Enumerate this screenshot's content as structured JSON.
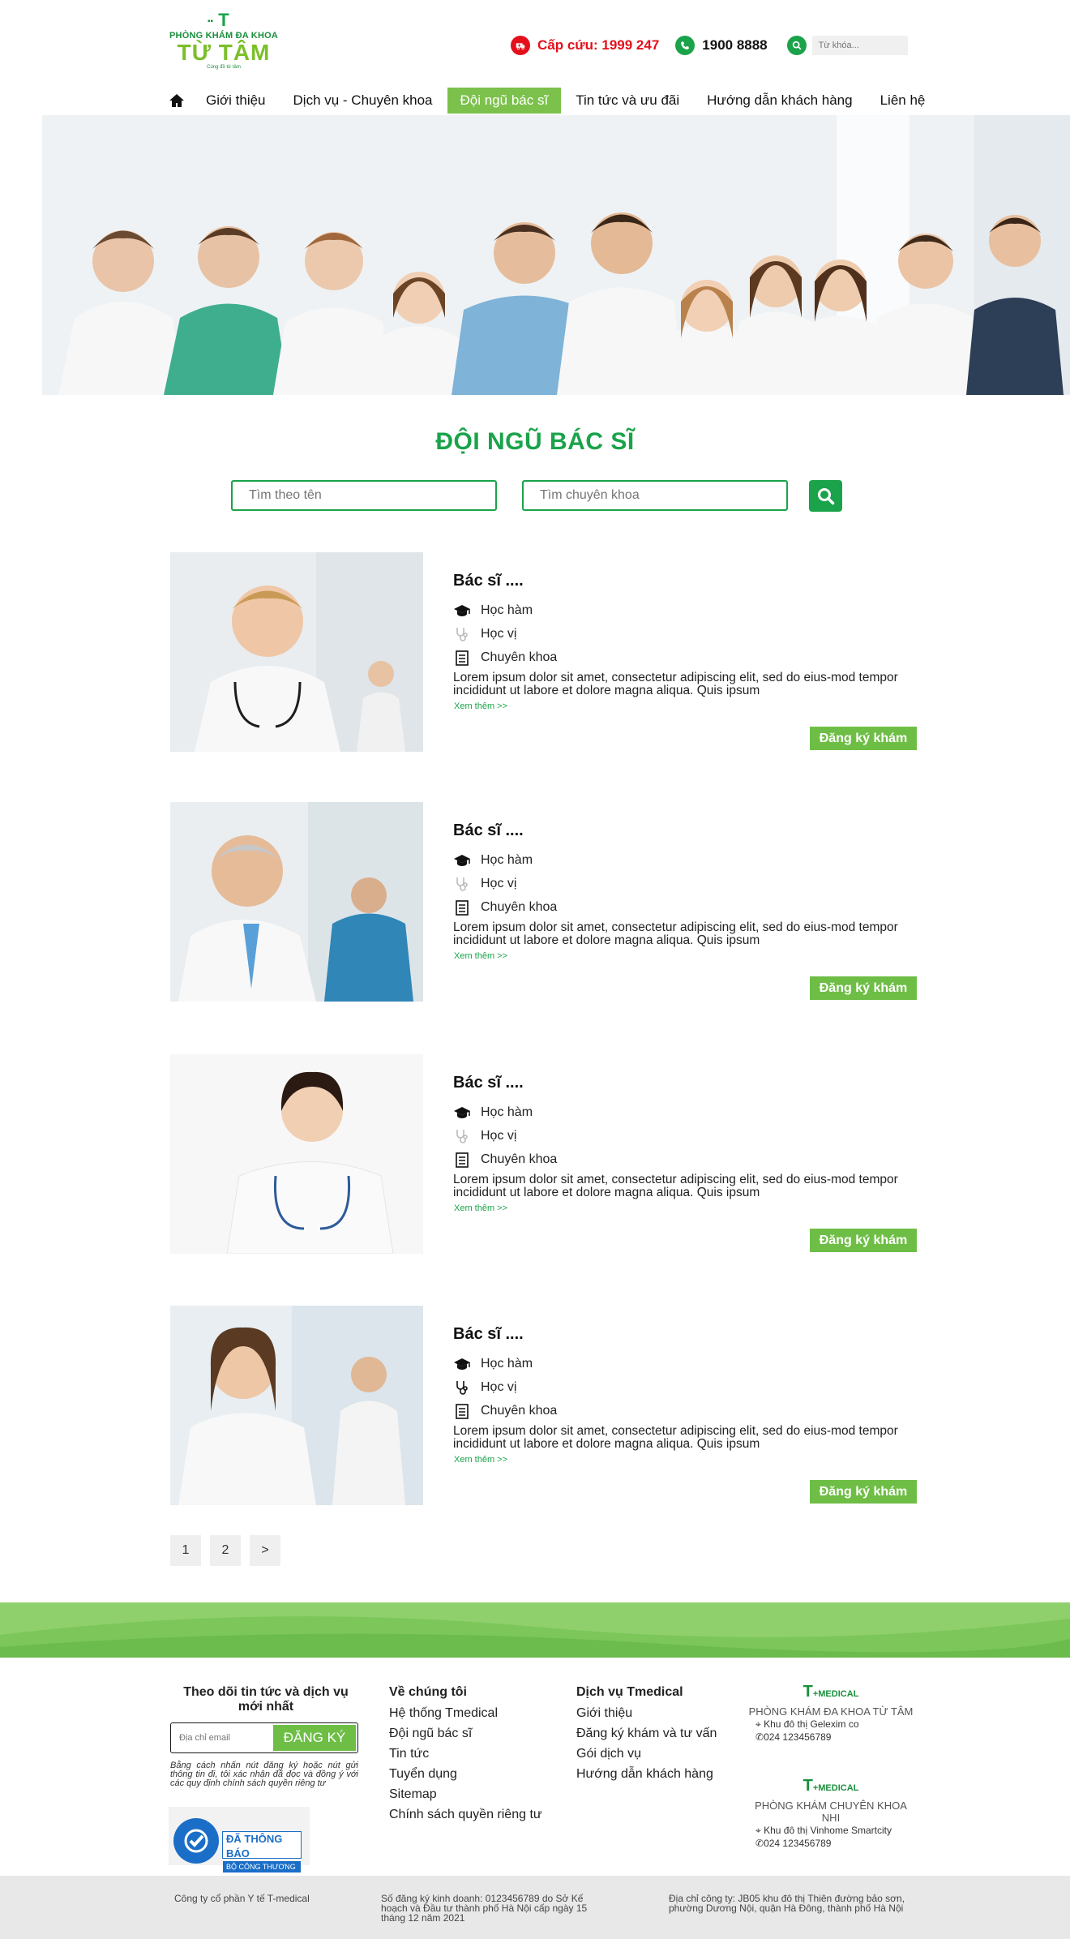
{
  "header": {
    "logo": {
      "mark": "T",
      "line1": "PHÒNG KHÁM ĐA KHOA",
      "line2": "TỪ TÂM",
      "tagline": "Cùng đồ từ tâm"
    },
    "emergency_label": "Cấp cứu: 1999 247",
    "hotline": "1900 8888",
    "search_placeholder": "Từ khóa..."
  },
  "nav": {
    "items": [
      {
        "label": "Giới thiệu"
      },
      {
        "label": "Dịch vụ - Chuyên khoa"
      },
      {
        "label": "Đội ngũ bác sĩ",
        "active": true
      },
      {
        "label": "Tin tức và ưu đãi"
      },
      {
        "label": "Hướng dẫn khách hàng"
      },
      {
        "label": "Liên hệ"
      }
    ]
  },
  "main": {
    "title": "ĐỘI NGŨ BÁC SĨ",
    "search_name_placeholder": "Tìm theo tên",
    "search_specialty_placeholder": "Tìm chuyên khoa"
  },
  "doctors": [
    {
      "name": "Bác sĩ ....",
      "academic_title": "Học hàm",
      "degree": "Học vị",
      "specialty": "Chuyên khoa",
      "description": "Lorem ipsum dolor sit amet, consectetur adipiscing elit, sed do eius-mod tempor incididunt ut labore et dolore magna aliqua. Quis ipsum",
      "more": "Xem thêm >>",
      "book": "Đăng ký khám"
    },
    {
      "name": "Bác sĩ ....",
      "academic_title": "Học hàm",
      "degree": "Học vị",
      "specialty": "Chuyên khoa",
      "description": "Lorem ipsum dolor sit amet, consectetur adipiscing elit, sed do eius-mod tempor incididunt ut labore et dolore magna aliqua. Quis ipsum",
      "more": "Xem thêm >>",
      "book": "Đăng ký khám"
    },
    {
      "name": "Bác sĩ ....",
      "academic_title": "Học hàm",
      "degree": "Học vị",
      "specialty": "Chuyên khoa",
      "description": "Lorem ipsum dolor sit amet, consectetur adipiscing elit, sed do eius-mod tempor incididunt ut labore et dolore magna aliqua. Quis ipsum",
      "more": "Xem thêm >>",
      "book": "Đăng ký khám"
    },
    {
      "name": "Bác sĩ ....",
      "academic_title": "Học hàm",
      "degree": "Học vị",
      "specialty": "Chuyên khoa",
      "description": "Lorem ipsum dolor sit amet, consectetur adipiscing elit, sed do eius-mod tempor incididunt ut labore et dolore magna aliqua. Quis ipsum",
      "more": "Xem thêm >>",
      "book": "Đăng ký khám"
    }
  ],
  "pagination": [
    "1",
    "2",
    ">"
  ],
  "footer": {
    "newsletter_title": "Theo dõi tin tức và dịch vụ mới nhất",
    "email_placeholder": "Địa chỉ email",
    "subscribe": "ĐĂNG KÝ",
    "note": "Bằng cách nhấn nút đăng ký hoặc nút gửi thông tin đi, tôi xác nhận đã đọc và đồng ý với các quy định chính sách quyền riêng tư",
    "badge_line1": "ĐÃ THÔNG BÁO",
    "badge_line2": "BỘ CÔNG THƯƠNG",
    "about": {
      "title": "Về chúng tôi",
      "links": [
        "Hệ thống Tmedical",
        "Đội ngũ bác sĩ",
        "Tin tức",
        "Tuyển dụng",
        "Sitemap",
        "Chính sách quyền riêng tư"
      ]
    },
    "services": {
      "title": "Dịch vụ Tmedical",
      "links": [
        "Giới thiệu",
        "Đăng ký khám và tư vấn",
        "Gói dịch vụ",
        "Hướng dẫn khách hàng"
      ]
    },
    "brands": [
      {
        "logo": "T",
        "logo_suffix": "+MEDICAL",
        "name": "PHÒNG KHÁM ĐA KHOA TỪ TÂM",
        "address": "Khu đô thị Gelexim co",
        "phone": "024 123456789"
      },
      {
        "logo": "T",
        "logo_suffix": "+MEDICAL",
        "name": "PHÒNG KHÁM CHUYÊN KHOA NHI",
        "address": "Khu đô thị Vinhome Smartcity",
        "phone": "024 123456789"
      }
    ],
    "company": "Công ty cổ phần Y tế T-medical",
    "registration": "Số đăng ký kinh doanh: 0123456789 do Sở Kế hoạch và Đầu tư thành phố Hà Nội cấp ngày 15 tháng 12 năm 2021",
    "company_address": "Địa chỉ công ty: JB05 khu đô thị Thiên đường bảo sơn, phường Dương Nội, quận Hà Đông, thành phố Hà Nội"
  },
  "colors": {
    "brand_green": "#1aa34a",
    "light_green": "#6ebe46",
    "emergency_red": "#e3101b"
  }
}
